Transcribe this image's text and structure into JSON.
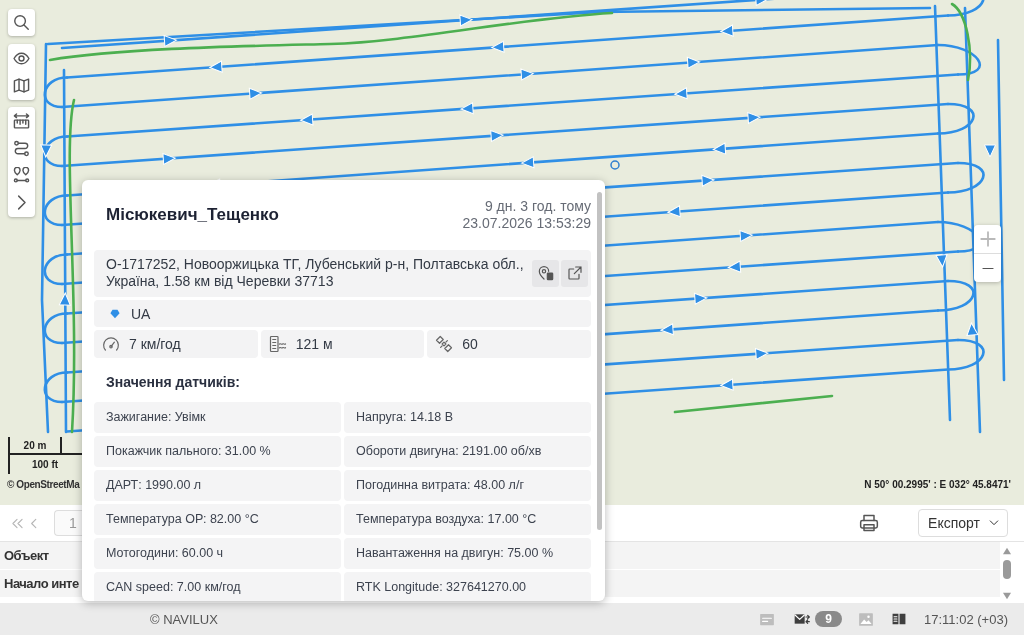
{
  "map": {
    "tool_groups": [
      {
        "tools": [
          {
            "kind": "search"
          }
        ]
      },
      {
        "tools": [
          {
            "kind": "visibility"
          },
          {
            "kind": "layers"
          }
        ]
      },
      {
        "tools": [
          {
            "kind": "measure"
          },
          {
            "kind": "route"
          },
          {
            "kind": "points"
          },
          {
            "kind": "expand"
          }
        ]
      }
    ],
    "zoom": [
      {
        "kind": "in",
        "disabled": true
      },
      {
        "kind": "out",
        "disabled": false
      }
    ],
    "scale": {
      "metric": "20 m",
      "imperial": "100 ft"
    },
    "attribution": "© OpenStreetMa",
    "coordinates": "N 50° 00.2995' : E 032° 45.8471'"
  },
  "popup": {
    "title": "Місюкевич_Тещенко",
    "time_ago": "9 дн. 3 год. тому",
    "timestamp": "23.07.2026 13:53:29",
    "address": "О-1717252, Новооржицька ТГ, Лубенський р-н, Полтавська обл., Україна, 1.58 км від Черевки 37713",
    "address_actions": [
      {
        "kind": "locate"
      },
      {
        "kind": "open"
      }
    ],
    "country": "UA",
    "stats": [
      {
        "kind": "speed",
        "value": "7 км/год"
      },
      {
        "kind": "altitude",
        "value": "121 м"
      },
      {
        "kind": "satellites",
        "value": "60"
      }
    ],
    "sensors_heading": "Значення датчиків:",
    "sensors": [
      "Зажигание: Увімк",
      "Напруга: 14.18 В",
      "Покажчик пального: 31.00 %",
      "Обороти двигуна: 2191.00 об/хв",
      "ДАРТ: 1990.00 л",
      "Погодинна витрата: 48.00 л/г",
      "Температура ОР: 82.00 °C",
      "Температура воздуха: 17.00 °C",
      "Мотогодини: 60.00 ч",
      "Навантаження на двигун: 75.00 %",
      "CAN speed: 7.00 км/год",
      "RTK Longitude: 327641270.00"
    ]
  },
  "report": {
    "pagination": {
      "buttons": [
        {
          "kind": "first",
          "disabled": true
        },
        {
          "kind": "previous",
          "disabled": true
        }
      ],
      "page": "1"
    },
    "export": "Експорт",
    "rows": [
      {
        "label": "Объект"
      },
      {
        "label": "Начало инте"
      }
    ]
  },
  "status_bar": {
    "copyright": "© NAVILUX",
    "indicators": [
      {
        "kind": "notes",
        "disabled": true
      },
      {
        "kind": "mail",
        "disabled": false,
        "badge": "9"
      },
      {
        "kind": "images",
        "disabled": true
      },
      {
        "kind": "reader",
        "disabled": false
      }
    ],
    "time": "17:11:02 (+03)"
  }
}
